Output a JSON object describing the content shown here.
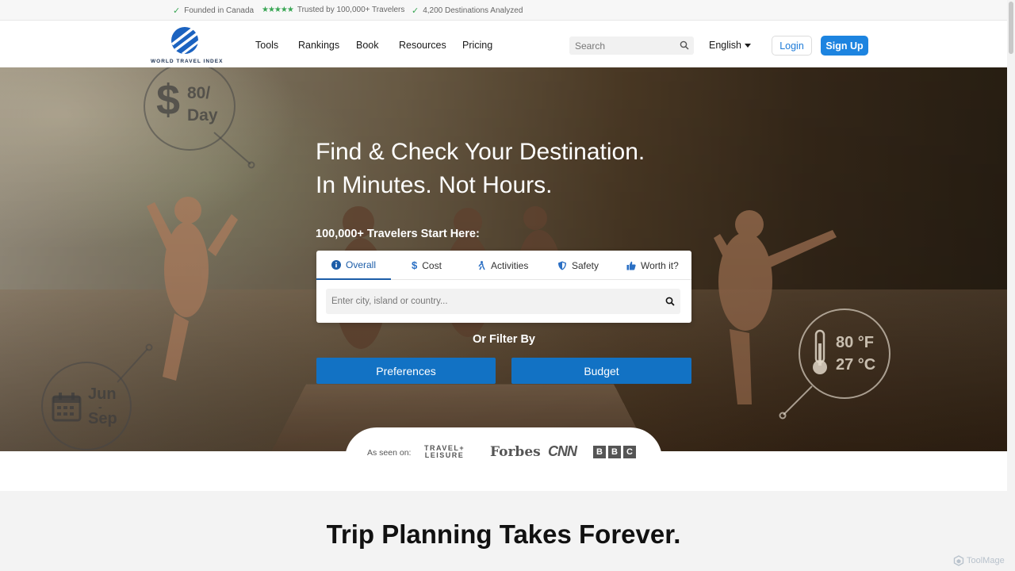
{
  "trustbar": {
    "founded": "Founded in Canada",
    "trusted": "Trusted by 100,000+ Travelers",
    "destinations": "4,200 Destinations Analyzed",
    "stars": "★★★★★"
  },
  "nav": {
    "logo_text": "WORLD TRAVEL INDEX",
    "links": [
      "Tools",
      "Rankings",
      "Book",
      "Resources",
      "Pricing"
    ],
    "search_placeholder": "Search",
    "language": "English",
    "login": "Login",
    "signup": "Sign Up"
  },
  "hero": {
    "title_line1": "Find & Check Your Destination.",
    "title_line2": "In Minutes. Not Hours.",
    "subtitle": "100,000+ Travelers Start Here:",
    "tabs": [
      "Overall",
      "Cost",
      "Activities",
      "Safety",
      "Worth it?"
    ],
    "active_tab": "Overall",
    "input_placeholder": "Enter city, island or country...",
    "or_filter": "Or Filter By",
    "preferences": "Preferences",
    "budget": "Budget",
    "badges": {
      "cost_value": "80/",
      "cost_unit": "Day",
      "cost_symbol": "$",
      "months_from": "Jun",
      "months_dash": "-",
      "months_to": "Sep",
      "temp_f": "80 °F",
      "temp_c": "27 °C"
    }
  },
  "seen_on": {
    "label": "As seen on:",
    "travel": "TRAVEL+",
    "leisure": "LEISURE",
    "forbes": "Forbes",
    "cnn": "CNN",
    "bbc": [
      "B",
      "B",
      "C"
    ]
  },
  "section2": {
    "title": "Trip Planning Takes Forever."
  },
  "watermark": "ToolMage",
  "colors": {
    "primary_blue": "#1272c4",
    "signup_blue": "#1d84e0",
    "trust_green": "#3aa655",
    "tab_active": "#1c5da8"
  }
}
